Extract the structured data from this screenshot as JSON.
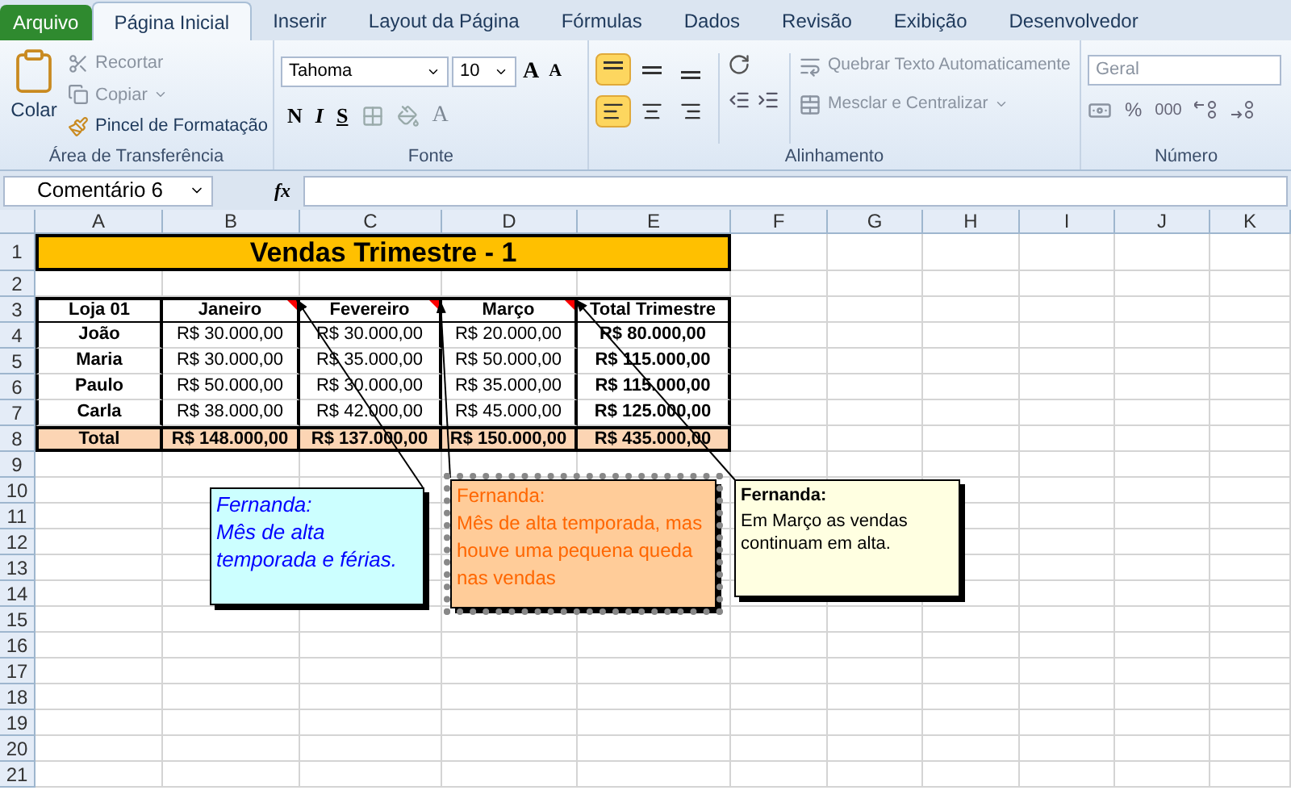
{
  "tabs": [
    {
      "label": "Arquivo",
      "kind": "file",
      "selected": false
    },
    {
      "label": "Página Inicial",
      "kind": "tab",
      "selected": true
    },
    {
      "label": "Inserir",
      "kind": "tab",
      "selected": false
    },
    {
      "label": "Layout da Página",
      "kind": "tab",
      "selected": false
    },
    {
      "label": "Fórmulas",
      "kind": "tab",
      "selected": false
    },
    {
      "label": "Dados",
      "kind": "tab",
      "selected": false
    },
    {
      "label": "Revisão",
      "kind": "tab",
      "selected": false
    },
    {
      "label": "Exibição",
      "kind": "tab",
      "selected": false
    },
    {
      "label": "Desenvolvedor",
      "kind": "tab",
      "selected": false
    }
  ],
  "ribbon": {
    "clipboard": {
      "label": "Área de Transferência",
      "paste": "Colar",
      "cut": "Recortar",
      "copy": "Copiar",
      "painter": "Pincel de Formatação"
    },
    "font": {
      "label": "Fonte",
      "font_name": "Tahoma",
      "font_size": "10",
      "grow": "A",
      "shrink": "A",
      "bold": "N",
      "italic": "I",
      "underline": "S",
      "font_color_button": "A"
    },
    "alignment": {
      "label": "Alinhamento",
      "vertical": [
        {
          "selected": true
        },
        {
          "selected": false
        },
        {
          "selected": false
        }
      ],
      "horizontal": [
        {
          "selected": true
        },
        {
          "selected": false
        },
        {
          "selected": false
        }
      ],
      "wrap": "Quebrar Texto Automaticamente",
      "merge": "Mesclar e Centralizar"
    },
    "number": {
      "label": "Número",
      "format": "Geral",
      "percent": "%",
      "thousands": "000"
    }
  },
  "formula_bar": {
    "name_box": "Comentário 6",
    "fx": "fx"
  },
  "sheet": {
    "columns": [
      "A",
      "B",
      "C",
      "D",
      "E",
      "F",
      "G",
      "H",
      "I",
      "J",
      "K"
    ],
    "row_numbers": [
      "1",
      "2",
      "3",
      "4",
      "5",
      "6",
      "7",
      "8",
      "9",
      "10",
      "11",
      "12",
      "13",
      "14",
      "15",
      "16",
      "17",
      "18",
      "19",
      "20",
      "21"
    ],
    "title": "Vendas Trimestre - 1",
    "header": [
      {
        "text": "Loja 01",
        "comment": false
      },
      {
        "text": "Janeiro",
        "comment": true
      },
      {
        "text": "Fevereiro",
        "comment": true
      },
      {
        "text": "Março",
        "comment": true
      },
      {
        "text": "Total Trimestre",
        "comment": false
      }
    ],
    "data": [
      [
        "João",
        "R$ 30.000,00",
        "R$ 30.000,00",
        "R$ 20.000,00",
        "R$ 80.000,00"
      ],
      [
        "Maria",
        "R$ 30.000,00",
        "R$ 35.000,00",
        "R$ 50.000,00",
        "R$ 115.000,00"
      ],
      [
        "Paulo",
        "R$ 50.000,00",
        "R$ 30.000,00",
        "R$ 35.000,00",
        "R$ 115.000,00"
      ],
      [
        "Carla",
        "R$ 38.000,00",
        "R$ 42.000,00",
        "R$ 45.000,00",
        "R$ 125.000,00"
      ]
    ],
    "total": [
      "Total",
      "R$ 148.000,00",
      "R$ 137.000,00",
      "R$ 150.000,00",
      "R$ 435.000,00"
    ]
  },
  "comments": [
    {
      "author": "Fernanda:",
      "text": "Mês de alta temporada e férias.",
      "kind": "italic",
      "color": "#ccffff",
      "selected": false
    },
    {
      "author": "Fernanda:",
      "text": "Mês de alta temporada, mas houve uma pequena queda nas vendas",
      "kind": "accent",
      "color": "#ffcc99",
      "selected": true
    },
    {
      "author": "Fernanda:",
      "text": "Em Março as vendas continuam em alta.",
      "kind": "plain",
      "color": "#ffffe1",
      "selected": false
    }
  ]
}
